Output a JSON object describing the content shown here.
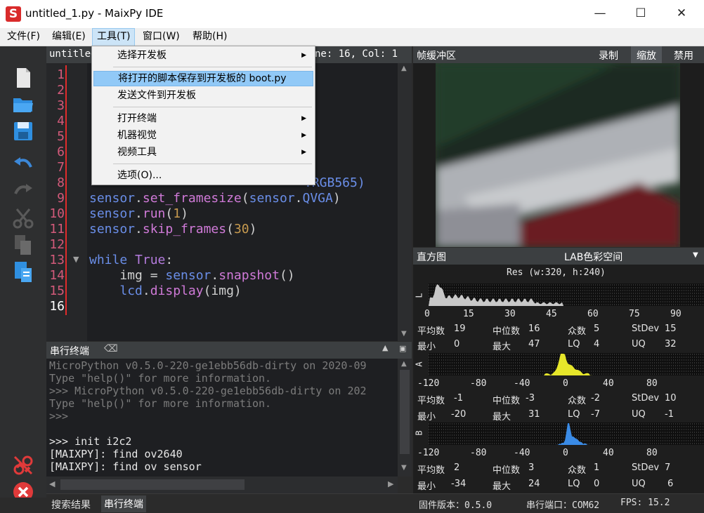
{
  "window": {
    "title": "untitled_1.py - MaixPy IDE",
    "app_icon_letter": "S",
    "minimize_glyph": "—",
    "maximize_glyph": "☐",
    "close_glyph": "✕"
  },
  "menubar": [
    "文件(F)",
    "编辑(E)",
    "工具(T)",
    "窗口(W)",
    "帮助(H)"
  ],
  "tools_menu": {
    "items": [
      {
        "label": "选择开发板",
        "submenu": true
      },
      {
        "label": "将打开的脚本保存到开发板的 boot.py",
        "highlighted": true
      },
      {
        "label": "发送文件到开发板"
      },
      {
        "label": "打开终端",
        "submenu": true
      },
      {
        "label": "机器视觉",
        "submenu": true
      },
      {
        "label": "视频工具",
        "submenu": true
      },
      {
        "label": "选项(O)..."
      }
    ]
  },
  "editor": {
    "tab_fragment_left": "untitled",
    "tab_fragment_right": "ne: 16, Col: 1",
    "line_numbers": [
      "1",
      "2",
      "3",
      "4",
      "5",
      "6",
      "7",
      "8",
      "9",
      "10",
      "11",
      "12",
      "13",
      "14",
      "15",
      "16"
    ],
    "current_line": "16",
    "partial_line_8": ".RGB565)",
    "line9": {
      "a": "sensor",
      "b": ".",
      "c": "set_framesize",
      "d": "(",
      "e": "sensor",
      "f": ".",
      "g": "QVGA",
      "h": ")"
    },
    "line10": {
      "a": "sensor",
      "b": ".",
      "c": "run",
      "d": "(",
      "e": "1",
      "f": ")"
    },
    "line11": {
      "a": "sensor",
      "b": ".",
      "c": "skip_frames",
      "d": "(",
      "e": "30",
      "f": ")"
    },
    "line13": {
      "a": "while",
      "b": " ",
      "c": "True",
      "d": ":"
    },
    "line14": {
      "a": "    img = ",
      "b": "sensor",
      "c": ".",
      "d": "snapshot",
      "e": "()"
    },
    "line15": {
      "a": "    ",
      "b": "lcd",
      "c": ".",
      "d": "display",
      "e": "(img)"
    }
  },
  "serial": {
    "title": "串行终端",
    "lines": [
      {
        "text": "MicroPython v0.5.0-220-ge1ebb56db-dirty on 2020-09",
        "style": "dim"
      },
      {
        "text": "Type \"help()\" for more information.",
        "style": "dim"
      },
      {
        "text": ">>> MicroPython v0.5.0-220-ge1ebb56db-dirty on 202",
        "style": "dim"
      },
      {
        "text": "Type \"help()\" for more information.",
        "style": "dim"
      },
      {
        "text": ">>>",
        "style": "dim"
      },
      {
        "text": "",
        "style": "dim"
      },
      {
        "text": ">>> init i2c2",
        "style": "bright"
      },
      {
        "text": "[MAIXPY]: find ov2640",
        "style": "bright"
      },
      {
        "text": "[MAIXPY]: find ov sensor",
        "style": "bright"
      }
    ]
  },
  "bottom_tabs": [
    "搜索结果",
    "串行终端"
  ],
  "status": {
    "firmware": "固件版本：0.5.0",
    "port": "串行端口：COM62",
    "fps": "FPS:  15.2"
  },
  "framebuffer": {
    "title": "帧缓冲区",
    "record": "录制",
    "zoom": "缩放",
    "disable": "禁用"
  },
  "histogram": {
    "title": "直方图",
    "colorspace": "LAB色彩空间",
    "resolution": "Res (w:320, h:240)",
    "channels": [
      {
        "label": "L",
        "color": "#c8c8c8",
        "ticks": [
          "0",
          "15",
          "30",
          "45",
          "60",
          "75",
          "90"
        ],
        "stats": {
          "mean_label": "平均数",
          "mean": "19",
          "median_label": "中位数",
          "median": "16",
          "mode_label": "众数",
          "mode": "5",
          "stdev_label": "StDev",
          "stdev": "15",
          "min_label": "最小",
          "min": "0",
          "max_label": "最大",
          "max": "47",
          "lq_label": "LQ",
          "lq": "4",
          "uq_label": "UQ",
          "uq": "32"
        }
      },
      {
        "label": "A",
        "color": "#e6e62a",
        "ticks": [
          "-120",
          "-80",
          "-40",
          "0",
          "40",
          "80"
        ],
        "stats": {
          "mean_label": "平均数",
          "mean": "-1",
          "median_label": "中位数",
          "median": "-3",
          "mode_label": "众数",
          "mode": "-2",
          "stdev_label": "StDev",
          "stdev": "10",
          "min_label": "最小",
          "min": "-20",
          "max_label": "最大",
          "max": "31",
          "lq_label": "LQ",
          "lq": "-7",
          "uq_label": "UQ",
          "uq": "-1"
        }
      },
      {
        "label": "B",
        "color": "#3a8be6",
        "ticks": [
          "-120",
          "-80",
          "-40",
          "0",
          "40",
          "80"
        ],
        "stats": {
          "mean_label": "平均数",
          "mean": "2",
          "median_label": "中位数",
          "median": "3",
          "mode_label": "众数",
          "mode": "1",
          "stdev_label": "StDev",
          "stdev": "7",
          "min_label": "最小",
          "min": "-34",
          "max_label": "最大",
          "max": "24",
          "lq_label": "LQ",
          "lq": "0",
          "uq_label": "UQ",
          "uq": "6"
        }
      }
    ]
  },
  "toolbar_icons": [
    "new-file-icon",
    "open-folder-icon",
    "save-icon",
    "undo-icon",
    "redo-icon",
    "cut-icon",
    "copy-icon",
    "paste-icon",
    "disconnect-icon",
    "stop-icon"
  ]
}
